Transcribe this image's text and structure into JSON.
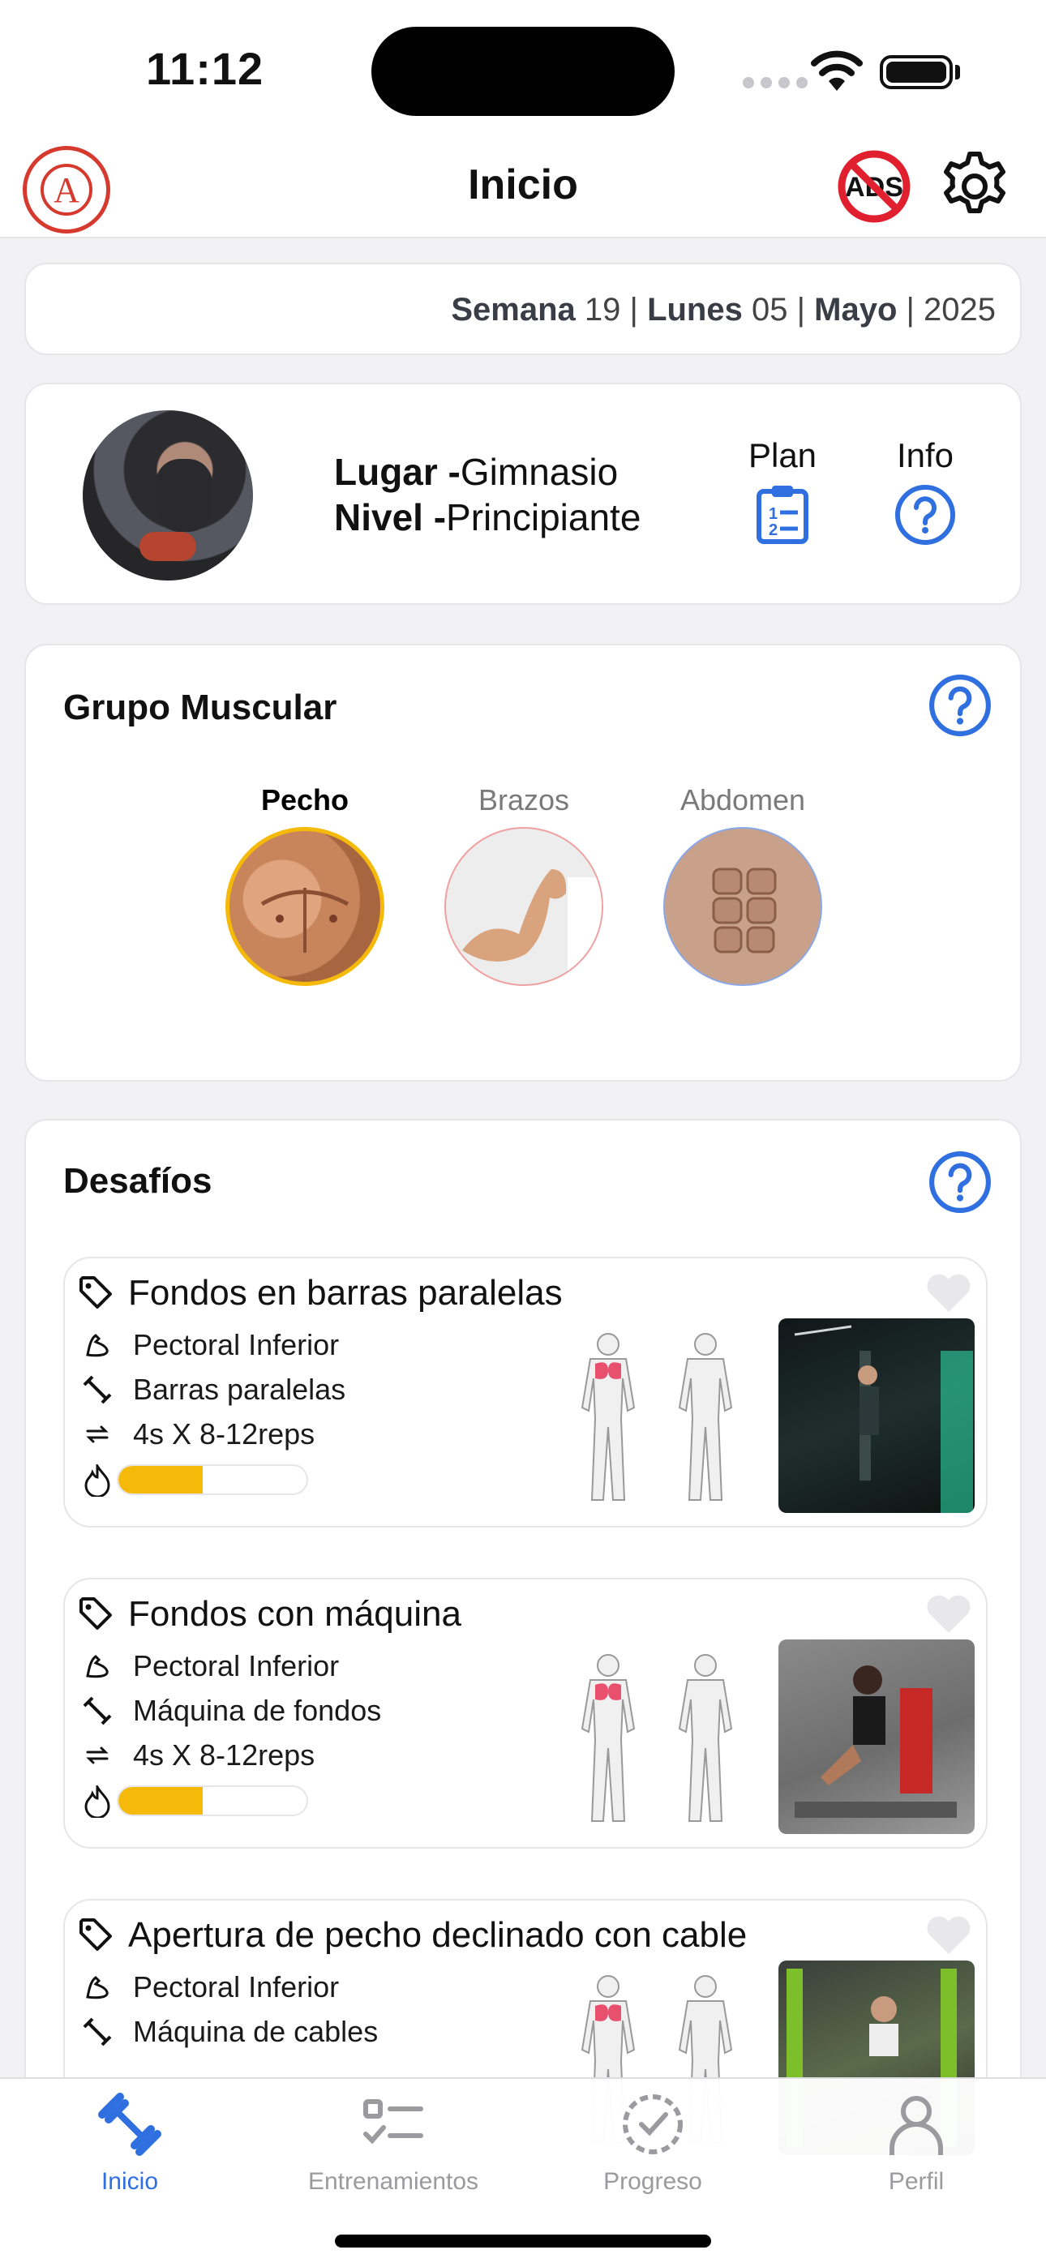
{
  "status_bar": {
    "time": "11:12"
  },
  "header": {
    "title": "Inicio",
    "logo_text": "A",
    "no_ads_text": "ADS"
  },
  "date": {
    "week_label": "Semana",
    "week": "19",
    "day_label": "Lunes",
    "day": "05",
    "month": "Mayo",
    "year": "2025",
    "separator": "|"
  },
  "profile": {
    "place_label": "Lugar -",
    "place": "Gimnasio",
    "level_label": "Nivel -",
    "level": "Principiante",
    "plan_label": "Plan",
    "info_label": "Info"
  },
  "muscle_group": {
    "title": "Grupo Muscular",
    "items": [
      {
        "label": "Pecho",
        "selected": true
      },
      {
        "label": "Brazos",
        "selected": false
      },
      {
        "label": "Abdomen",
        "selected": false
      }
    ]
  },
  "challenges": {
    "title": "Desafíos",
    "items": [
      {
        "title": "Fondos en barras paralelas",
        "muscle": "Pectoral Inferior",
        "equipment": "Barras paralelas",
        "sets": "4s X 8-12reps",
        "difficulty": 0.45
      },
      {
        "title": "Fondos con máquina",
        "muscle": "Pectoral Inferior",
        "equipment": "Máquina de fondos",
        "sets": "4s X 8-12reps",
        "difficulty": 0.45
      },
      {
        "title": "Apertura de pecho declinado con cable",
        "muscle": "Pectoral Inferior",
        "equipment": "Máquina de cables",
        "sets": "",
        "difficulty": 0
      }
    ]
  },
  "tabs": [
    {
      "label": "Inicio",
      "active": true
    },
    {
      "label": "Entrenamientos",
      "active": false
    },
    {
      "label": "Progreso",
      "active": false
    },
    {
      "label": "Perfil",
      "active": false
    }
  ],
  "colors": {
    "accent": "#2f6fe0",
    "selected_ring": "#f5b90a",
    "difficulty": "#f5b90a",
    "chest_highlight": "#e8506e",
    "ads_red": "#e0202e"
  }
}
